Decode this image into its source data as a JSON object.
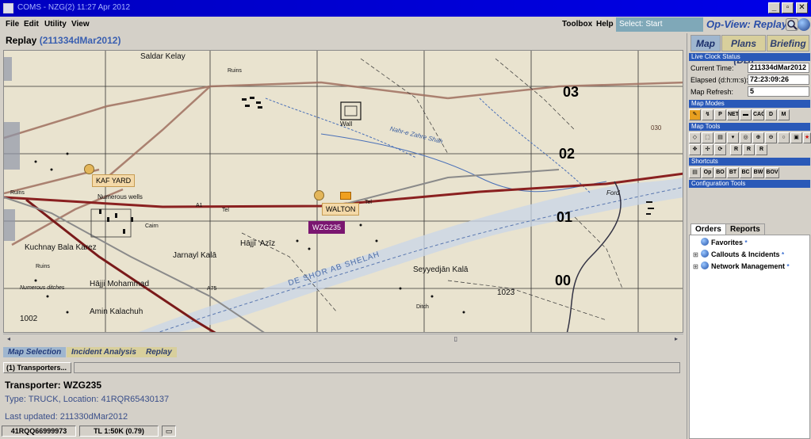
{
  "window": {
    "title": "COMS - NZG(2) 11:27 Apr 2012",
    "controls": [
      "_",
      "▫",
      "✕"
    ]
  },
  "menubar": {
    "items": [
      "File",
      "Edit",
      "Utility",
      "View"
    ],
    "right_items": [
      "Toolbox",
      "Help"
    ],
    "select_box": "Select: Start",
    "brand": "Op-View: Replay"
  },
  "replay": {
    "label": "Replay",
    "timestamp": "(211334dMar2012)"
  },
  "map": {
    "grid_numbers": [
      "03",
      "02",
      "01",
      "00"
    ],
    "labels": {
      "saldar_kelay": "Saldar Kelay",
      "ruins1": "Ruins",
      "wall": "Wall",
      "nahr": "Nahr-e Zahre Shah",
      "ruins2": "Ruins",
      "numerous_wells": "Numerous wells",
      "jarnayl_kala": "Jarnayl Kalā",
      "hajji_aziz": "Hājjī 'Azīz",
      "kuchnay": "Kuchnay Bala Karez",
      "hajji_mohammad": "Hājji Mohammad",
      "amin": "Amin Kalachuh",
      "seyyedjan": "Seyyedjān Kalā",
      "ford": "Ford",
      "elev_1023": "1023",
      "elev_1002": "1002",
      "elev_030": "030",
      "dasht": "DE SHOR AB SHELAH",
      "road_a1": "A1",
      "road_a75": "A75",
      "tel1": "Tel",
      "tel2": "Tel",
      "ditch": "Ditch",
      "cairn": "Cairn",
      "numerous_ditches": "Numerous ditches",
      "ruins_left": "Ruins"
    },
    "markers": {
      "kaf_yard": "KAF YARD",
      "walton": "WALTON",
      "wzg235": "WZG235"
    }
  },
  "bottom_tabs": [
    "Map Selection",
    "Incident Analysis",
    "Replay"
  ],
  "transporters_button": "(1) Transporters...",
  "detail": {
    "title": "Transporter: WZG235",
    "type_line": "Type: TRUCK, Location: 41RQR65430137",
    "updated": "Last updated: 211330dMar2012"
  },
  "statusbar": {
    "coords": "41RQQ66999973",
    "scale": "TL 1:50K (0.79)"
  },
  "right_panel": {
    "tabs": [
      "Map",
      "Plans (DB)",
      "Briefing"
    ],
    "live_clock": {
      "header": "Live Clock Status",
      "current_time_label": "Current Time:",
      "current_time": "211334dMar2012",
      "elapsed_label": "Elapsed (d:h:m:s):",
      "elapsed": "72:23:09:26",
      "refresh_label": "Map Refresh:",
      "refresh": "5"
    },
    "map_modes_header": "Map Modes",
    "map_tools_header": "Map Tools",
    "shortcuts_header": "Shortcuts",
    "shortcut_labels": [
      "Op",
      "BO",
      "BT",
      "BC",
      "BW",
      "BOV"
    ],
    "config_header": "Configuration Tools",
    "order_tabs": [
      "Orders",
      "Reports"
    ],
    "tree": [
      {
        "label": "Favorites",
        "mark": "*"
      },
      {
        "label": "Callouts & Incidents",
        "mark": "*"
      },
      {
        "label": "Network Management",
        "mark": "*"
      }
    ]
  },
  "colors": {
    "titlebar": "#0000c0",
    "map_bg": "#e9e3cf",
    "road": "#8a2020",
    "section_header": "#2a59b8",
    "marker_purple": "#7a1670"
  }
}
